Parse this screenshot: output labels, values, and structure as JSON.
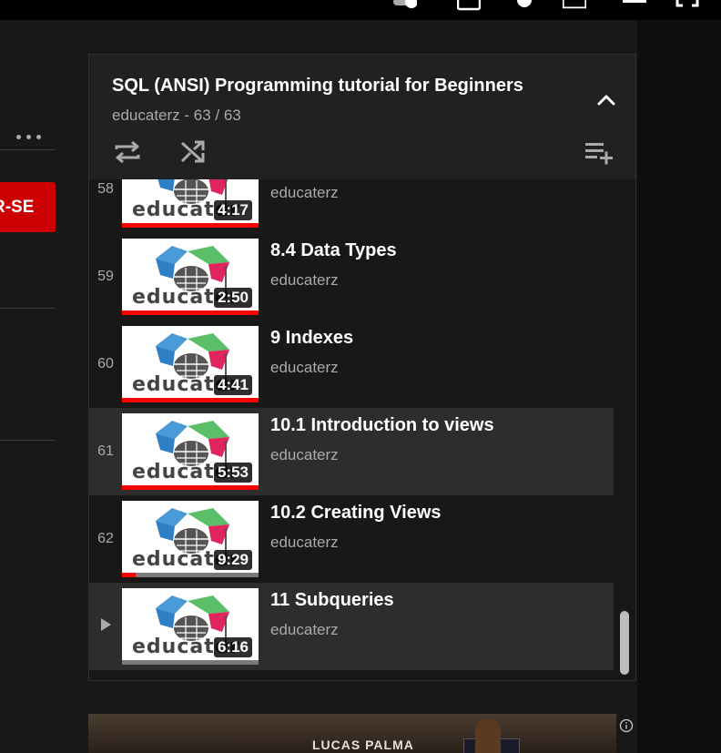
{
  "playlist": {
    "title": "SQL (ANSI) Programming tutorial for Beginners",
    "subtitle": "educaterz - 63 / 63",
    "videos": [
      {
        "index": "58",
        "title": "",
        "channel": "educaterz",
        "duration": "4:17",
        "watched_fraction": 1.0,
        "active": false
      },
      {
        "index": "59",
        "title": "8.4 Data Types",
        "channel": "educaterz",
        "duration": "2:50",
        "watched_fraction": 1.0,
        "active": false
      },
      {
        "index": "60",
        "title": "9 Indexes",
        "channel": "educaterz",
        "duration": "4:41",
        "watched_fraction": 1.0,
        "active": false
      },
      {
        "index": "61",
        "title": "10.1 Introduction to views",
        "channel": "educaterz",
        "duration": "5:53",
        "watched_fraction": 1.0,
        "active": true
      },
      {
        "index": "62",
        "title": "10.2 Creating Views",
        "channel": "educaterz",
        "duration": "9:29",
        "watched_fraction": 0.1,
        "active": false
      },
      {
        "index": "",
        "title": "11 Subqueries",
        "channel": "educaterz",
        "duration": "6:16",
        "watched_fraction": 0.0,
        "active": true,
        "now_playing": true
      }
    ]
  },
  "thumbnail_text": "educater",
  "subscribe_label": "R-SE",
  "ad_text": "LUCAS PALMA",
  "icons": {
    "more": "more-horiz-icon",
    "collapse": "chevron-up-icon",
    "loop": "repeat-icon",
    "shuffle": "shuffle-icon",
    "save": "playlist-add-icon",
    "play": "play-arrow-icon",
    "info": "info-icon"
  },
  "colors": {
    "brand_red": "#cc0000",
    "progress_red": "#ff0000",
    "panel_bg": "#212121",
    "active_row": "#2d2d2d"
  }
}
